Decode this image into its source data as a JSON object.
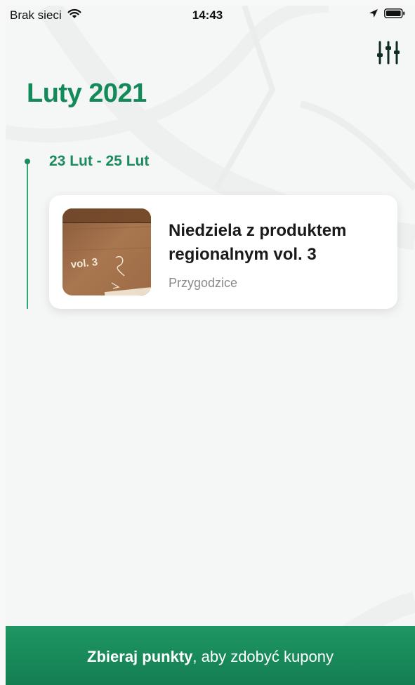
{
  "status_bar": {
    "carrier": "Brak sieci",
    "time": "14:43",
    "wifi_icon": "wifi-icon",
    "location_icon": "location-arrow-icon",
    "battery_icon": "battery-icon"
  },
  "header": {
    "month_title": "Luty 2021",
    "filter_icon": "sliders-icon"
  },
  "timeline": {
    "groups": [
      {
        "date_range": "23 Lut - 25 Lut",
        "events": [
          {
            "title": "Niedziela z produktem regionalnym vol. 3",
            "location": "Przygodzice",
            "thumbnail_text": "vol. 3"
          }
        ]
      }
    ]
  },
  "bottom_bar": {
    "bold_text": "Zbieraj punkty",
    "rest_text": ", aby zdobyć kupony"
  },
  "colors": {
    "accent": "#138a5a",
    "bottom_bar": "#1a8a5c",
    "card_bg": "#ffffff",
    "location_text": "#8a8a8a"
  }
}
